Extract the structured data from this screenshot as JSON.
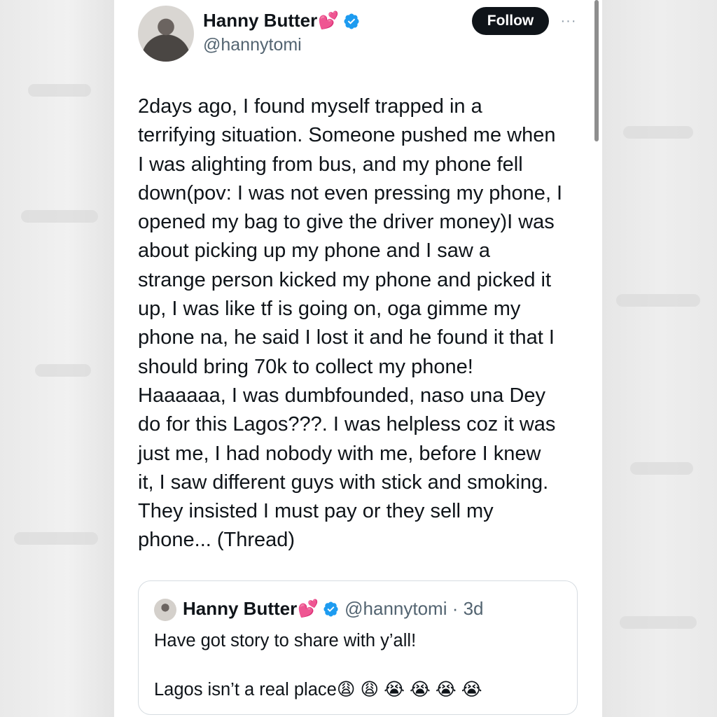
{
  "tweet": {
    "display_name": "Hanny Butter",
    "name_emoji": "💕",
    "handle": "@hannytomi",
    "follow_label": "Follow",
    "more_label": "···",
    "text": "2days ago, I found myself trapped in a\nterrifying situation. Someone pushed me when\nI was alighting from bus, and my phone fell\ndown(pov: I was not even pressing my phone, I\nopened my bag to give the driver money)I was\nabout picking up my phone and I saw a\nstrange person kicked my phone and picked it\nup, I was like tf is going on, oga gimme my\nphone na, he said I lost it and he found it that I\nshould bring 70k to collect my phone!\nHaaaaaa, I was dumbfounded, naso una Dey\ndo for this Lagos???. I was helpless coz it was\njust me, I had nobody with me, before I knew\nit, I saw different guys with stick and smoking.\nThey insisted I must pay or they sell my\nphone... (Thread)"
  },
  "quote": {
    "display_name": "Hanny Butter",
    "name_emoji": "💕",
    "handle_time": "@hannytomi · 3d",
    "text": "Have got story to share with y’all!\n\nLagos isn’t a real place😩 😩 😭 😭 😭 😭"
  },
  "colors": {
    "verified_blue": "#1d9bf0",
    "follow_bg": "#0f1419",
    "heart_pink": "#e23e9b"
  },
  "icons": {
    "verified": "verified-badge-icon",
    "more": "more-dots-icon"
  }
}
